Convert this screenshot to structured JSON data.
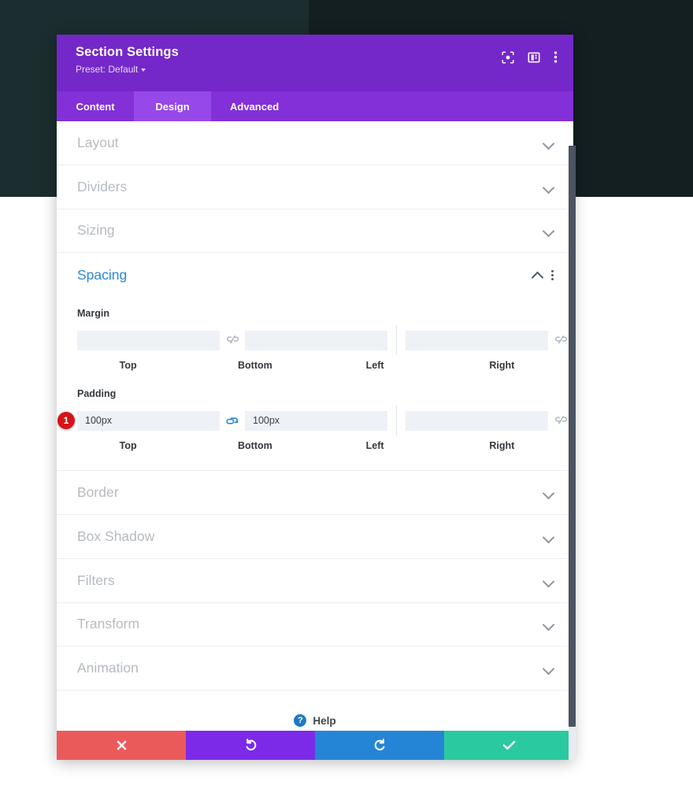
{
  "window": {
    "title": "Section Settings",
    "preset_label": "Preset: Default",
    "header_icons": [
      {
        "name": "focus-target-icon",
        "label": "Focus"
      },
      {
        "name": "panel-layout-icon",
        "label": "Layout"
      },
      {
        "name": "kebab-menu-icon",
        "label": "More options"
      }
    ]
  },
  "tabs": [
    {
      "label": "Content",
      "active": false
    },
    {
      "label": "Design",
      "active": true
    },
    {
      "label": "Advanced",
      "active": false
    }
  ],
  "sections": {
    "layout": {
      "title": "Layout",
      "state": "collapsed"
    },
    "dividers": {
      "title": "Dividers",
      "state": "collapsed"
    },
    "sizing": {
      "title": "Sizing",
      "state": "collapsed"
    },
    "spacing": {
      "title": "Spacing",
      "state": "expanded"
    },
    "border": {
      "title": "Border",
      "state": "collapsed"
    },
    "box_shadow": {
      "title": "Box Shadow",
      "state": "collapsed"
    },
    "filters": {
      "title": "Filters",
      "state": "collapsed"
    },
    "transform": {
      "title": "Transform",
      "state": "collapsed"
    },
    "animation": {
      "title": "Animation",
      "state": "collapsed"
    }
  },
  "spacing": {
    "margin": {
      "label": "Margin",
      "link_state_left": "unlinked",
      "link_state_right": "unlinked",
      "fields": [
        {
          "label": "Top",
          "value": "",
          "placeholder": ""
        },
        {
          "label": "Bottom",
          "value": "",
          "placeholder": ""
        },
        {
          "label": "Left",
          "value": "",
          "placeholder": ""
        },
        {
          "label": "Right",
          "value": "",
          "placeholder": ""
        }
      ]
    },
    "padding": {
      "label": "Padding",
      "link_state_left": "linked",
      "link_state_right": "unlinked",
      "badge": "1",
      "fields": [
        {
          "label": "Top",
          "value": "100px",
          "placeholder": ""
        },
        {
          "label": "Bottom",
          "value": "100px",
          "placeholder": ""
        },
        {
          "label": "Left",
          "value": "",
          "placeholder": ""
        },
        {
          "label": "Right",
          "value": "",
          "placeholder": ""
        }
      ]
    }
  },
  "help": {
    "label": "Help",
    "icon_glyph": "?"
  },
  "footer": [
    {
      "name": "cancel-button",
      "icon": "close-icon",
      "glyph": "✖",
      "color": "#eb5a5a"
    },
    {
      "name": "undo-button",
      "icon": "undo-icon",
      "glyph": "↺",
      "color": "#7d2ae8"
    },
    {
      "name": "redo-button",
      "icon": "redo-icon",
      "glyph": "↻",
      "color": "#2485d6"
    },
    {
      "name": "save-button",
      "icon": "check-icon",
      "glyph": "✔",
      "color": "#2bc9a0"
    }
  ],
  "colors": {
    "header_purple": "#7528c9",
    "tabs_purple": "#8330d8",
    "tab_active_purple": "#9648e8",
    "open_section_blue": "#2b87da",
    "collapsed_gray": "#b6bbc0",
    "badge_red": "#d8121a",
    "link_active_blue": "#2b87da",
    "input_bg": "#eef1f6",
    "bg_dark_left": "#1b2d2e",
    "bg_dark_right": "#141f21"
  }
}
